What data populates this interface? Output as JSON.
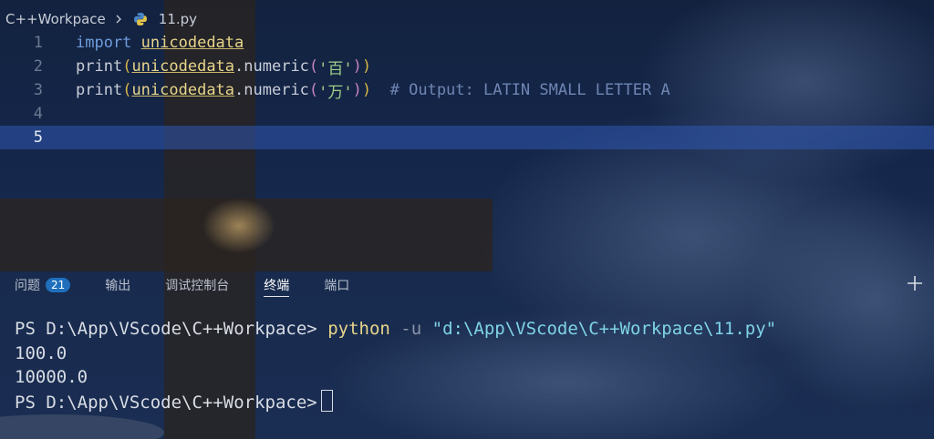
{
  "breadcrumb": {
    "folder": "C++Workpace",
    "file": "11.py"
  },
  "code": {
    "lines": [
      {
        "num": "1"
      },
      {
        "num": "2"
      },
      {
        "num": "3"
      },
      {
        "num": "4"
      },
      {
        "num": "5"
      }
    ],
    "l1_kw": "import",
    "l1_mod": "unicodedata",
    "l2_fn": "print",
    "l2_mod": "unicodedata",
    "l2_call": ".numeric",
    "l2_str": "'百'",
    "l3_fn": "print",
    "l3_mod": "unicodedata",
    "l3_call": ".numeric",
    "l3_str": "'万'",
    "l3_comment": "# Output: LATIN SMALL LETTER A"
  },
  "panel": {
    "tabs": [
      {
        "label": "问题"
      },
      {
        "label": "输出"
      },
      {
        "label": "调试控制台"
      },
      {
        "label": "终端"
      },
      {
        "label": "端口"
      }
    ],
    "problems_count": "21"
  },
  "terminal": {
    "prompt1": "PS D:\\App\\VScode\\C++Workpace>",
    "cmd": "python",
    "flag": "-u",
    "arg": "\"d:\\App\\VScode\\C++Workpace\\11.py\"",
    "out1": "100.0",
    "out2": "10000.0",
    "prompt2": "PS D:\\App\\VScode\\C++Workpace>"
  },
  "colors": {
    "active_line": "#3058b0",
    "badge": "#1f6fbd"
  },
  "icons": [
    "chevron-right-icon",
    "python-file-icon",
    "plus-icon"
  ]
}
